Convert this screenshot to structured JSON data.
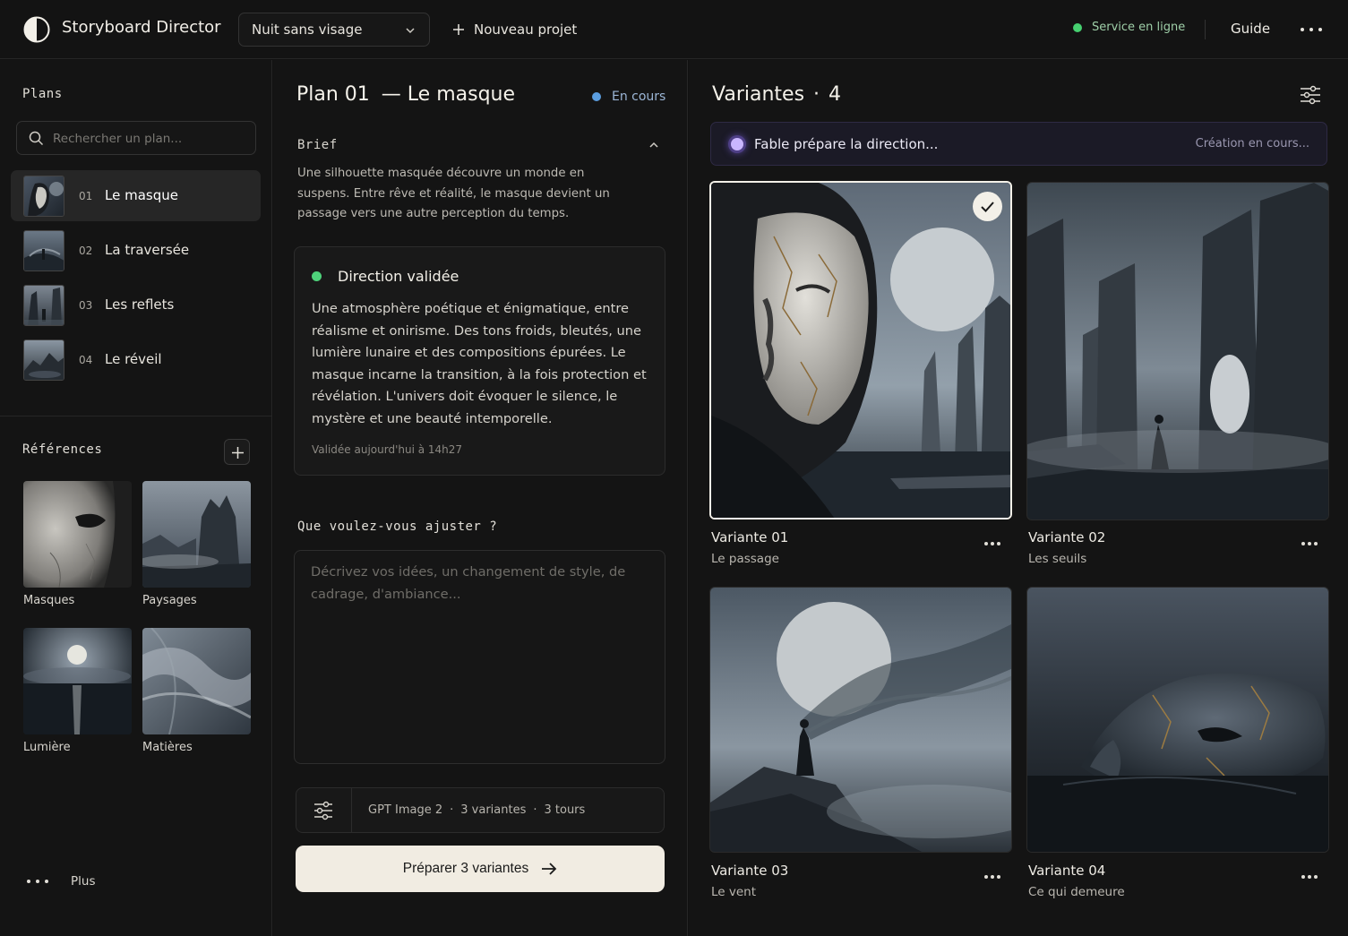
{
  "header": {
    "app_title": "Storyboard Director",
    "project": "Nuit sans visage",
    "new_project": "Nouveau projet",
    "status": "Service en ligne",
    "guide": "Guide"
  },
  "sidebar": {
    "plans_title": "Plans",
    "search_placeholder": "Rechercher un plan...",
    "plans": [
      {
        "num": "01",
        "name": "Le masque"
      },
      {
        "num": "02",
        "name": "La traversée"
      },
      {
        "num": "03",
        "name": "Les reflets"
      },
      {
        "num": "04",
        "name": "Le réveil"
      }
    ],
    "refs_title": "Références",
    "refs": [
      {
        "label": "Masques"
      },
      {
        "label": "Paysages"
      },
      {
        "label": "Lumière"
      },
      {
        "label": "Matières"
      }
    ],
    "more": "Plus"
  },
  "plan": {
    "title": "Plan 01",
    "subtitle": "— Le masque",
    "status": "En cours",
    "brief_title": "Brief",
    "brief": "Une silhouette masquée découvre un monde en suspens. Entre rêve et réalité, le masque devient un passage vers une autre perception du temps.",
    "direction": {
      "title": "Direction validée",
      "body": "Une atmosphère poétique et énigmatique, entre réalisme et onirisme. Des tons froids, bleutés, une lumière lunaire et des compositions épurées. Le masque incarne la transition, à la fois protection et révélation. L'univers doit évoquer le silence, le mystère et une beauté intemporelle.",
      "time": "Validée aujourd'hui à 14h27"
    },
    "adjust_title": "Que voulez-vous ajuster ?",
    "adjust_placeholder": "Décrivez vos idées, un changement de style, de cadrage, d'ambiance...",
    "settings": {
      "model": "GPT Image 2",
      "variants": "3 variantes",
      "turns": "3 tours",
      "sep": "·"
    },
    "prepare_button": "Préparer 3 variantes"
  },
  "variants": {
    "title": "Variantes",
    "count": "4",
    "dot": "·",
    "banner_msg": "Fable prépare la direction...",
    "banner_status": "Création en cours...",
    "items": [
      {
        "name": "Variante 01",
        "sub": "Le passage",
        "selected": true
      },
      {
        "name": "Variante 02",
        "sub": "Les seuils"
      },
      {
        "name": "Variante 03",
        "sub": "Le vent"
      },
      {
        "name": "Variante 04",
        "sub": "Ce qui demeure"
      }
    ]
  },
  "colors": {
    "accent_online": "#46d070",
    "accent_status": "#5b9ee0",
    "accent_validated": "#4ed27a",
    "accent_progress": "#a58bff",
    "button_bg": "#f1ece2"
  }
}
